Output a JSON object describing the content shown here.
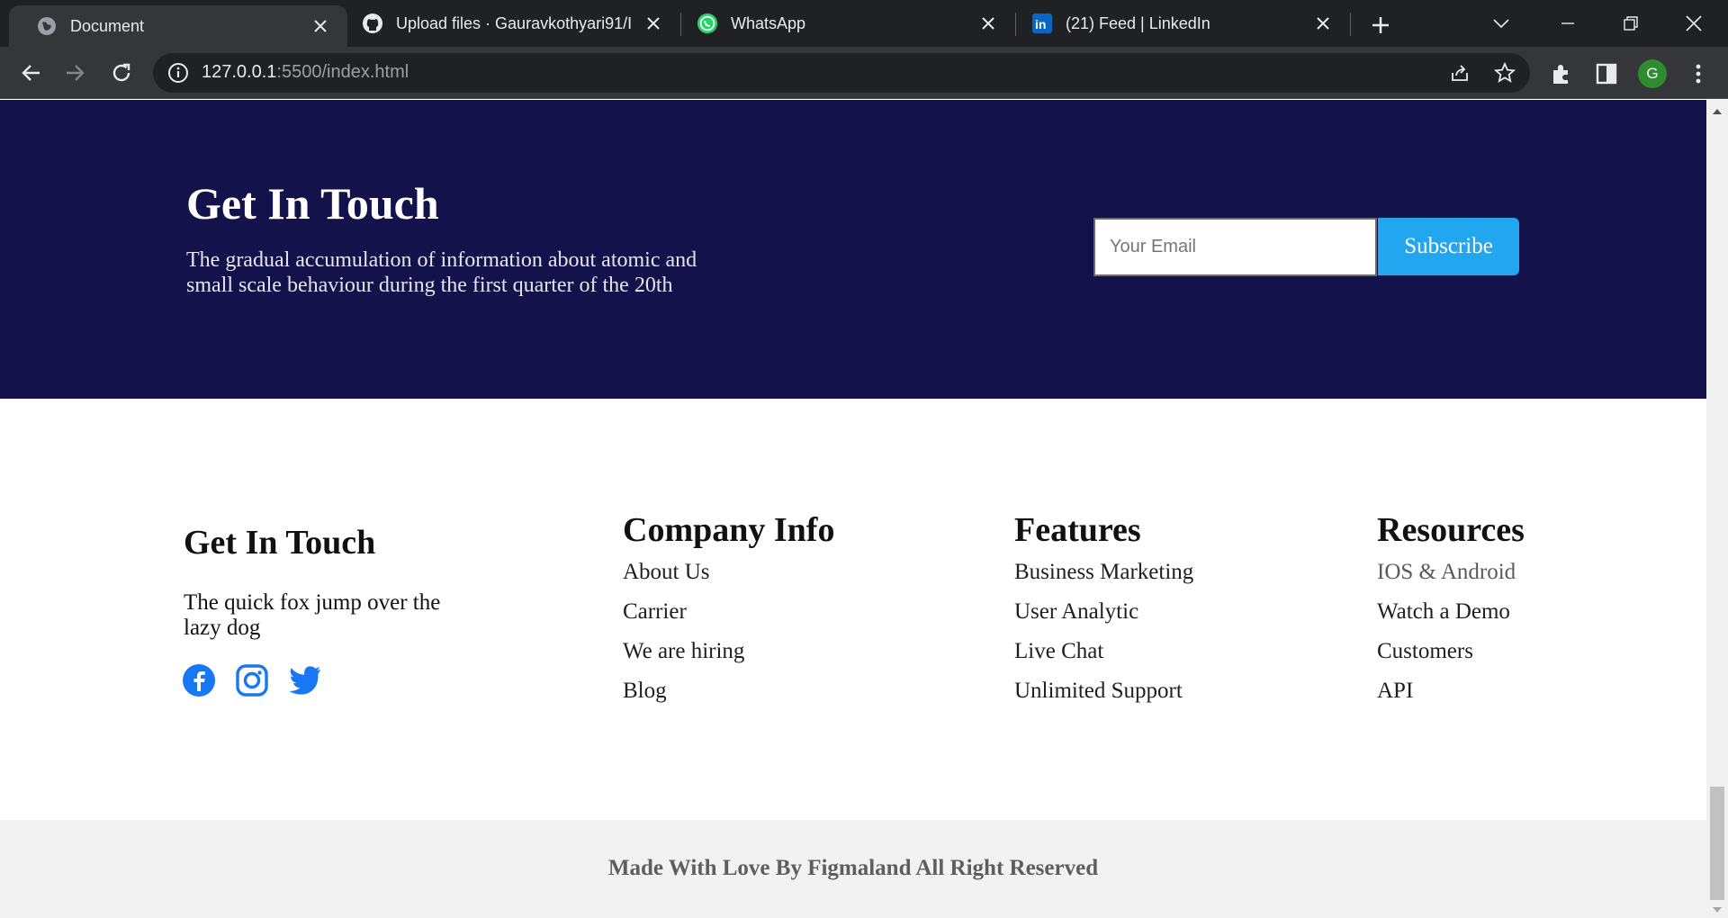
{
  "browser": {
    "tabs": [
      {
        "title": "Document",
        "icon": "globe-icon"
      },
      {
        "title": "Upload files · Gauravkothyari91/I",
        "icon": "github-icon"
      },
      {
        "title": "WhatsApp",
        "icon": "whatsapp-icon"
      },
      {
        "title": "(21) Feed | LinkedIn",
        "icon": "linkedin-icon"
      }
    ],
    "url_host": "127.0.0.1",
    "url_rest": ":5500/index.html",
    "profile_initial": "G"
  },
  "subscribe": {
    "title": "Get In Touch",
    "text": "The gradual accumulation of information about atomic and small scale behaviour during the first quarter of the 20th",
    "email_placeholder": "Your Email",
    "button_label": "Subscribe"
  },
  "footer": {
    "about": {
      "title": "Get In Touch",
      "text": "The quick fox jump over the lazy dog",
      "socials": [
        "facebook-icon",
        "instagram-icon",
        "twitter-icon"
      ]
    },
    "columns": [
      {
        "title": "Company Info",
        "links": [
          "About Us",
          "Carrier",
          "We are hiring",
          "Blog"
        ]
      },
      {
        "title": "Features",
        "links": [
          "Business Marketing",
          "User Analytic",
          "Live Chat",
          "Unlimited Support"
        ]
      },
      {
        "title": "Resources",
        "links": [
          "IOS & Android",
          "Watch a Demo",
          "Customers",
          "API"
        ]
      }
    ],
    "copyright": "Made With Love By Figmaland All Right Reserved"
  },
  "colors": {
    "band_bg": "#13124a",
    "subscribe_button": "#23a6f0",
    "social_icon": "#1877f2",
    "bottom_bar": "#f2f2f2"
  }
}
